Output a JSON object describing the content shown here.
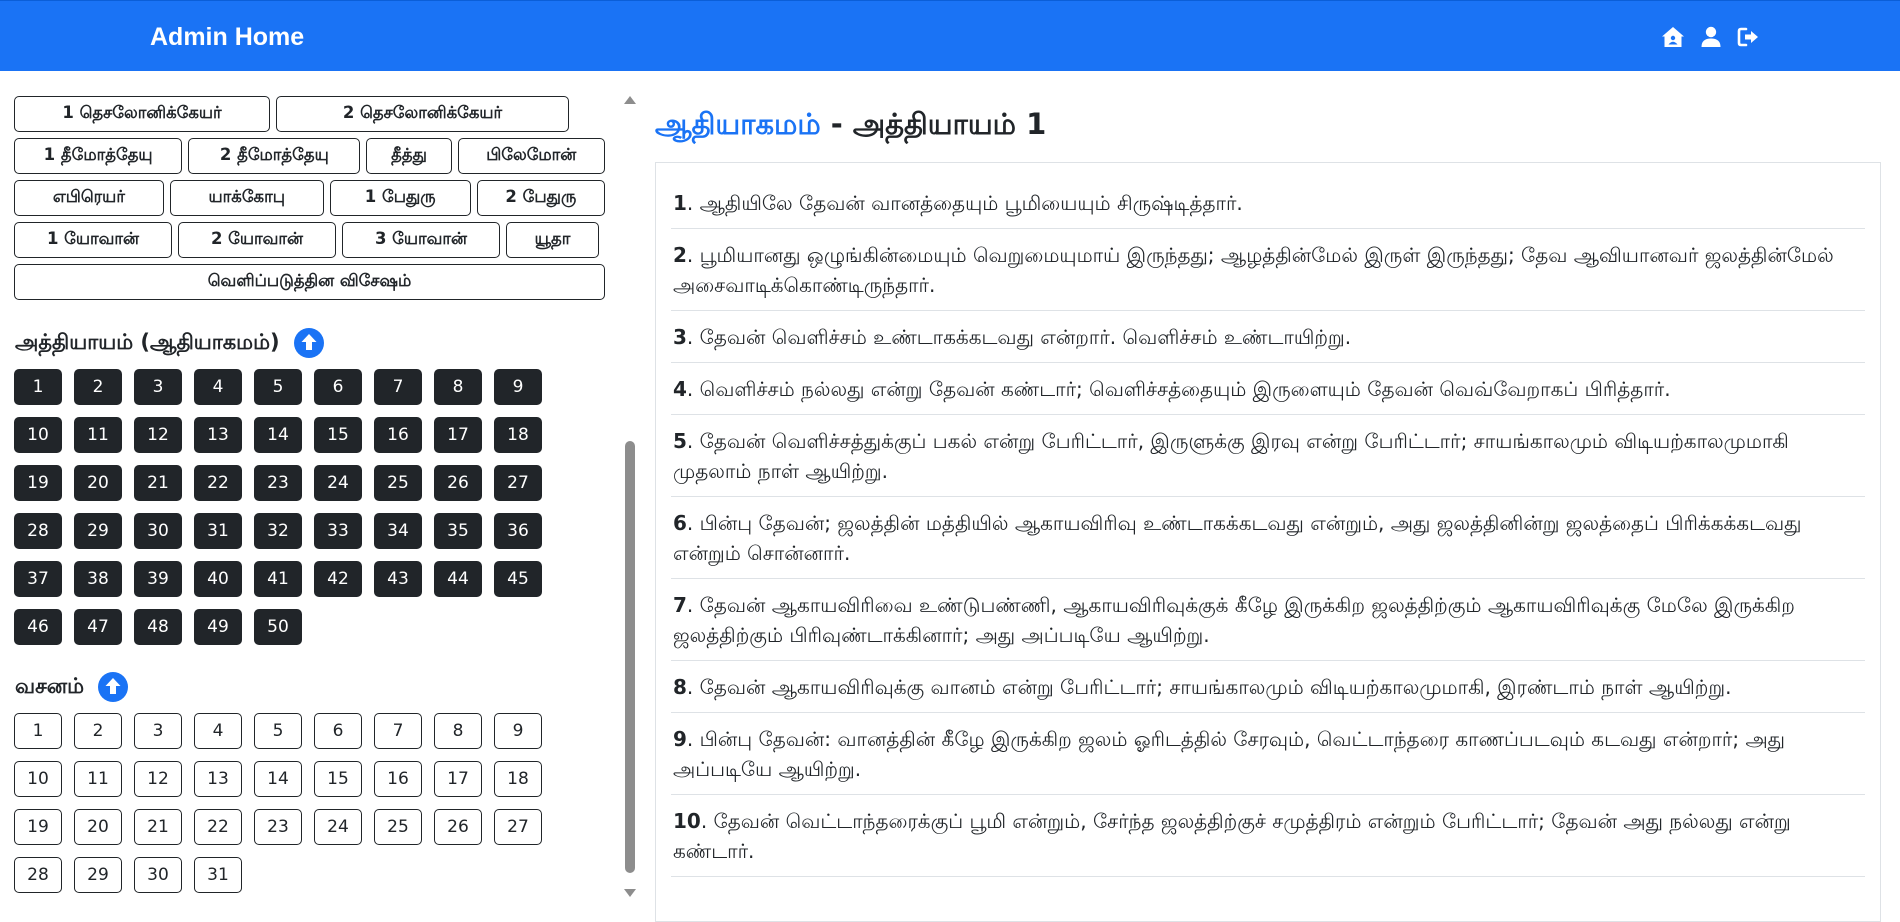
{
  "navbar": {
    "brand": "Admin Home",
    "icons": [
      "home-icon",
      "user-icon",
      "logout-icon"
    ],
    "color": "#1a73f5"
  },
  "books": {
    "rows": [
      [
        "1 தெசலோனிக்கேயர்",
        "2 தெசலோனிக்கேயர்"
      ],
      [
        "1 தீமோத்தேயு",
        "2 தீமோத்தேயு",
        "தீத்து",
        "பிலேமோன்"
      ],
      [
        "எபிரெயர்",
        "யாக்கோபு",
        "1 பேதுரு",
        "2 பேதுரு"
      ],
      [
        "1 யோவான்",
        "2 யோவான்",
        "3 யோவான்",
        "யூதா"
      ],
      [
        "வெளிப்படுத்தின விசேஷம்"
      ]
    ]
  },
  "chapters": {
    "title": "அத்தியாயம் (ஆதியாகமம்)",
    "count": 50
  },
  "verses_nav": {
    "title": "வசனம்",
    "count": 31
  },
  "content": {
    "book": "ஆதியாகமம்",
    "separator": " - ",
    "chapter_label": "அத்தியாயம் 1",
    "verses": [
      {
        "num": "1",
        "text": ". ஆதியிலே தேவன் வானத்தையும் பூமியையும் சிருஷ்டித்தார்."
      },
      {
        "num": "2",
        "text": ". பூமியானது ஒழுங்கின்மையும் வெறுமையுமாய் இருந்தது; ஆழத்தின்மேல் இருள் இருந்தது; தேவ ஆவியானவர் ஜலத்தின்மேல் அசைவாடிக்கொண்டிருந்தார்."
      },
      {
        "num": "3",
        "text": ". தேவன் வெளிச்சம் உண்டாகக்கடவது என்றார். வெளிச்சம் உண்டாயிற்று."
      },
      {
        "num": "4",
        "text": ". வெளிச்சம் நல்லது என்று தேவன் கண்டார்; வெளிச்சத்தையும் இருளையும் தேவன் வெவ்வேறாகப் பிரித்தார்."
      },
      {
        "num": "5",
        "text": ". தேவன் வெளிச்சத்துக்குப் பகல் என்று பேரிட்டார், இருளுக்கு இரவு என்று பேரிட்டார்; சாயங்காலமும் விடியற்காலமுமாகி முதலாம் நாள் ஆயிற்று."
      },
      {
        "num": "6",
        "text": ". பின்பு தேவன்; ஜலத்தின் மத்தியில் ஆகாயவிரிவு உண்டாகக்கடவது என்றும், அது ஜலத்தினின்று ஜலத்தைப் பிரிக்கக்கடவது என்றும் சொன்னார்."
      },
      {
        "num": "7",
        "text": ". தேவன் ஆகாயவிரிவை உண்டுபண்ணி, ஆகாயவிரிவுக்குக் கீழே இருக்கிற ஜலத்திற்கும் ஆகாயவிரிவுக்கு மேலே இருக்கிற ஜலத்திற்கும் பிரிவுண்டாக்கினார்; அது அப்படியே ஆயிற்று."
      },
      {
        "num": "8",
        "text": ". தேவன் ஆகாயவிரிவுக்கு வானம் என்று பேரிட்டார்; சாயங்காலமும் விடியற்காலமுமாகி, இரண்டாம் நாள் ஆயிற்று."
      },
      {
        "num": "9",
        "text": ". பின்பு தேவன்: வானத்தின் கீழே இருக்கிற ஜலம் ஓரிடத்தில் சேரவும், வெட்டாந்தரை காணப்படவும் கடவது என்றார்; அது அப்படியே ஆயிற்று."
      },
      {
        "num": "10",
        "text": ". தேவன் வெட்டாந்தரைக்குப் பூமி என்றும், சேர்ந்த ஜலத்திற்குச் சமுத்திரம் என்றும் பேரிட்டார்; தேவன் அது நல்லது என்று கண்டார்."
      }
    ]
  }
}
